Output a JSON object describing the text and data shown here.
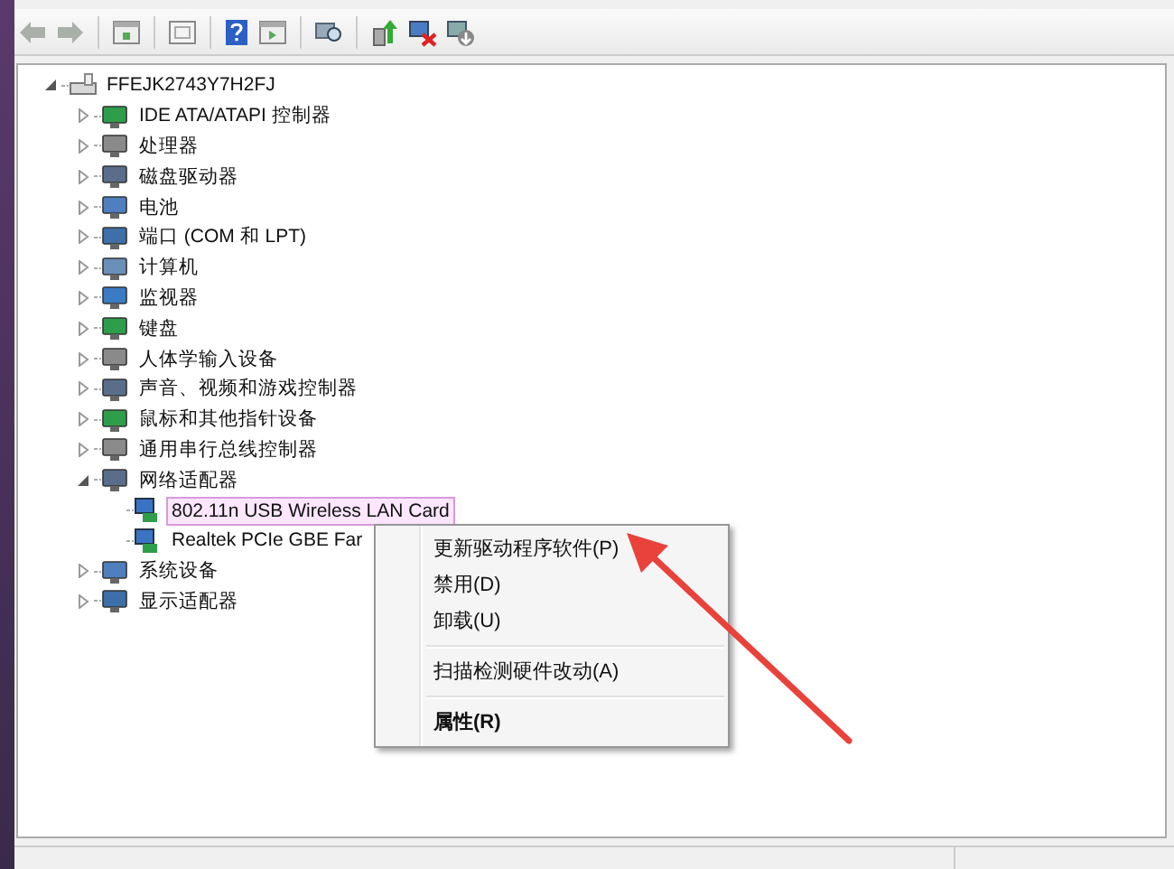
{
  "tree": [
    {
      "label": "FFEJK2743Y7H2FJ",
      "expanded": true,
      "selected": false,
      "children": [
        {
          "label": "IDE ATA/ATAPI 控制器",
          "expanded": false,
          "selected": false
        },
        {
          "label": "处理器",
          "expanded": false,
          "selected": false
        },
        {
          "label": "磁盘驱动器",
          "expanded": false,
          "selected": false
        },
        {
          "label": "电池",
          "expanded": false,
          "selected": false
        },
        {
          "label": "端口 (COM 和 LPT)",
          "expanded": false,
          "selected": false
        },
        {
          "label": "计算机",
          "expanded": false,
          "selected": false
        },
        {
          "label": "监视器",
          "expanded": false,
          "selected": false
        },
        {
          "label": "键盘",
          "expanded": false,
          "selected": false
        },
        {
          "label": "人体学输入设备",
          "expanded": false,
          "selected": false
        },
        {
          "label": "声音、视频和游戏控制器",
          "expanded": false,
          "selected": false
        },
        {
          "label": "鼠标和其他指针设备",
          "expanded": false,
          "selected": false
        },
        {
          "label": "通用串行总线控制器",
          "expanded": false,
          "selected": false
        },
        {
          "label": "网络适配器",
          "expanded": true,
          "selected": false,
          "children": [
            {
              "label": "802.11n USB Wireless LAN Card",
              "selected": true
            },
            {
              "label": "Realtek PCIe GBE Far",
              "selected": false
            }
          ]
        },
        {
          "label": "系统设备",
          "expanded": false,
          "selected": false
        },
        {
          "label": "显示适配器",
          "expanded": false,
          "selected": false
        }
      ]
    }
  ],
  "context_menu": [
    {
      "kind": "item",
      "label": "更新驱动程序软件(P)",
      "default": false
    },
    {
      "kind": "item",
      "label": "禁用(D)",
      "default": false
    },
    {
      "kind": "item",
      "label": "卸载(U)",
      "default": false
    },
    {
      "kind": "separator"
    },
    {
      "kind": "item",
      "label": "扫描检测硬件改动(A)",
      "default": false
    },
    {
      "kind": "separator"
    },
    {
      "kind": "item",
      "label": "属性(R)",
      "default": true
    }
  ]
}
